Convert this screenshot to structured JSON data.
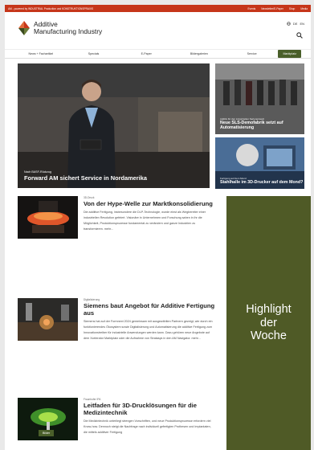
{
  "topbar": {
    "tagline": "AM - powered by INDUSTRIAL Production und KONSTRUKTIONSPRAXIS",
    "links": [
      "Events",
      "Newsletter/E-Paper",
      "Shop",
      "Media"
    ]
  },
  "header": {
    "logo_line1": "Additive",
    "logo_line2": "Manufacturing Industry",
    "lang_de": "DE",
    "lang_en": "EN"
  },
  "nav": {
    "items": [
      "News + Fachartikel",
      "Specials",
      "E-Paper",
      "Bildergalerien",
      "Service"
    ],
    "button": "Marktplatz"
  },
  "hero": {
    "kicker": "Nach BASF-Rückzug",
    "title": "Forward AM sichert Service in Nordamerika"
  },
  "side1": {
    "kicker": "Additiv für den industriellen Serieneinsatz",
    "title": "Neue SLS-Demofabrik setzt auf Automatisierung"
  },
  "side2": {
    "kicker": "Fertigung auf dem Mond",
    "title": "Stahlhalle im 3D-Drucker auf dem Mond?"
  },
  "articles": [
    {
      "kicker": "3D-Druck",
      "title": "Von der Hype-Welle zur Marktkonsolidierung",
      "text": "Die additive Fertigung, insbesondere die DLP-Technologie, wurde einst als Wegbereiter einer industriellen Revolution gefeiert. Visionäre in Unternehmen und Forschung sahen in ihr die Möglichkeit, Produktionsprozesse fundamental zu verändern und ganze Industrien zu transformieren. mehr..."
    },
    {
      "kicker": "Digitalisierung",
      "title": "Siemens baut Angebot für Additive Fertigung aus",
      "text": "Siemens hat auf der Formnext 2024 gemeinsam mit ausgewählten Partnern gezeigt, wie durch ein funktionierendes Ökosystem sowie Digitalisierung und Automatisierung die additive Fertigung zum Innovationstreiber für industrielle Anwendungen werden kann. Dazu gehören neue Angebote auf dem Xcelerator Marktplatz oder die Aufnahme von Stratasys in den AM Navigator. mehr..."
    },
    {
      "kicker": "Fraunhofer IPA",
      "title": "Leitfaden für 3D-Drucklösungen für die Medizintechnik",
      "text": "Die Medizintechnik unterliegt strengen Vorschriften, und neue Produktionsprozesse erfordern viel Know-how. Dennoch steigt die Nachfrage nach individuell gefertigten Prothesen und Implantaten, die mittels additiver Fertigung",
      "badge": "Bilder"
    }
  ],
  "highlight": {
    "line1": "Highlight",
    "line2": "der",
    "line3": "Woche"
  },
  "colors": {
    "topbar": "#c6361a",
    "brand_green": "#4a5f2a",
    "highlight_bg": "#4f5a26",
    "logo_red": "#c6361a",
    "logo_dark": "#3a4a1e"
  }
}
